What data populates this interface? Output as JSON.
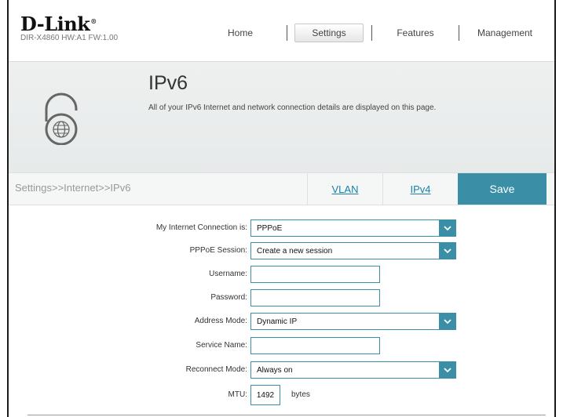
{
  "brand": {
    "logo": "D-Link",
    "model_info": "DIR-X4860 HW:A1 FW:1.00"
  },
  "nav": {
    "home": "Home",
    "settings": "Settings",
    "features": "Features",
    "management": "Management",
    "active": "Settings"
  },
  "hero": {
    "icon": "globe-lock-icon",
    "title": "IPv6",
    "description": "All of your IPv6 Internet and network connection details are displayed on this page."
  },
  "tabbar": {
    "breadcrumb": "Settings>>Internet>>IPv6",
    "vlan": "VLAN",
    "ipv4": "IPv4",
    "save": "Save"
  },
  "form": {
    "connection": {
      "label": "My Internet Connection is:",
      "value": "PPPoE"
    },
    "session": {
      "label": "PPPoE Session:",
      "value": "Create a new session"
    },
    "username": {
      "label": "Username:",
      "value": ""
    },
    "password": {
      "label": "Password:",
      "value": ""
    },
    "address_mode": {
      "label": "Address Mode:",
      "value": "Dynamic IP"
    },
    "service_name": {
      "label": "Service Name:",
      "value": ""
    },
    "reconnect_mode": {
      "label": "Reconnect Mode:",
      "value": "Always on"
    },
    "mtu": {
      "label": "MTU:",
      "value": "1492",
      "unit": "bytes"
    }
  },
  "colors": {
    "accent": "#3a8fa6",
    "link": "#1a80a8",
    "hero_bg": "#eceeee"
  }
}
